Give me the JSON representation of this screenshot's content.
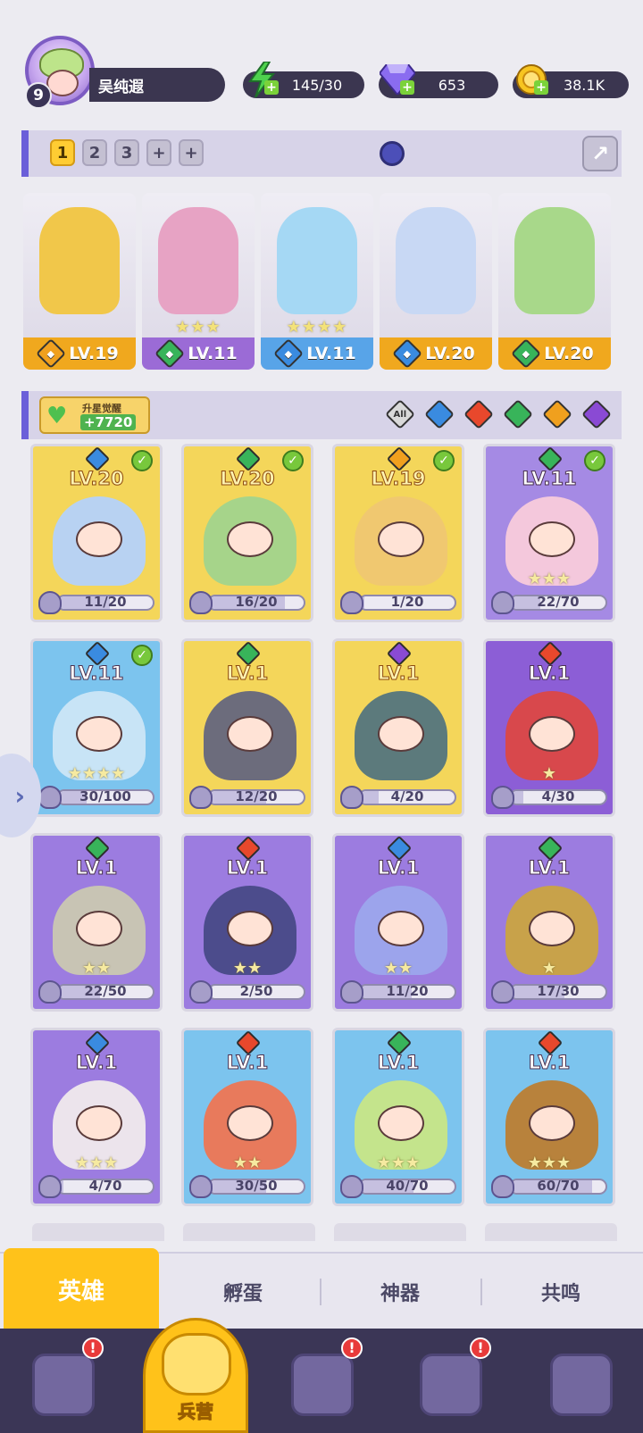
{
  "player": {
    "level": "9",
    "name": "吴纯遐"
  },
  "resources": {
    "energy": "145/30",
    "gems": "653",
    "gold": "38.1K"
  },
  "team_tabs": [
    "1",
    "2",
    "3",
    "+",
    "+"
  ],
  "team": [
    {
      "level": "LV.19",
      "element": "light",
      "stars": "",
      "strip_color": "#f0a81e",
      "art_color": "#f1c74a"
    },
    {
      "level": "LV.11",
      "element": "nature",
      "stars": "★★★",
      "strip_color": "#9b6bd6",
      "art_color": "#e7a3c4"
    },
    {
      "level": "LV.11",
      "element": "water",
      "stars": "★★★★",
      "strip_color": "#58a4e8",
      "art_color": "#a5d8f4"
    },
    {
      "level": "LV.20",
      "element": "water",
      "stars": "",
      "strip_color": "#f0a81e",
      "art_color": "#c8d8f4"
    },
    {
      "level": "LV.20",
      "element": "nature",
      "stars": "",
      "strip_color": "#f0a81e",
      "art_color": "#a8d88a"
    }
  ],
  "awaken": {
    "label": "升星觉醒",
    "value": "+7720"
  },
  "filters": [
    "All",
    "water",
    "fire",
    "nature",
    "light",
    "dark"
  ],
  "heroes": [
    {
      "level": "LV.20",
      "element": "water",
      "checked": true,
      "stars": "",
      "progress": "11/20",
      "fill": 0.55,
      "bg": "#f4d65a",
      "art": "#b8d2f2"
    },
    {
      "level": "LV.20",
      "element": "nature",
      "checked": true,
      "stars": "",
      "progress": "16/20",
      "fill": 0.8,
      "bg": "#f4d65a",
      "art": "#a6d48a"
    },
    {
      "level": "LV.19",
      "element": "light",
      "checked": true,
      "stars": "",
      "progress": "1/20",
      "fill": 0.05,
      "bg": "#f4d65a",
      "art": "#f0c870"
    },
    {
      "level": "LV.11",
      "element": "nature",
      "checked": true,
      "stars": "★★★",
      "progress": "22/70",
      "fill": 0.31,
      "bg": "#a58ae4",
      "art": "#f4c8dc"
    },
    {
      "level": "LV.11",
      "element": "water",
      "checked": true,
      "stars": "★★★★",
      "progress": "30/100",
      "fill": 0.3,
      "bg": "#7cc4ee",
      "art": "#c8e4f6"
    },
    {
      "level": "LV.1",
      "element": "nature",
      "checked": false,
      "stars": "",
      "progress": "12/20",
      "fill": 0.6,
      "bg": "#f4d65a",
      "art": "#6c6c7c"
    },
    {
      "level": "LV.1",
      "element": "dark",
      "checked": false,
      "stars": "",
      "progress": "4/20",
      "fill": 0.2,
      "bg": "#f4d65a",
      "art": "#5c7a7c"
    },
    {
      "level": "LV.1",
      "element": "fire",
      "checked": false,
      "stars": "★",
      "progress": "4/30",
      "fill": 0.13,
      "bg": "#8c5ed6",
      "art": "#d8484c"
    },
    {
      "level": "LV.1",
      "element": "nature",
      "checked": false,
      "stars": "★★",
      "progress": "22/50",
      "fill": 0.44,
      "bg": "#9c7ce0",
      "art": "#c8c4b4"
    },
    {
      "level": "LV.1",
      "element": "fire",
      "checked": false,
      "stars": "★★",
      "progress": "2/50",
      "fill": 0.04,
      "bg": "#9c7ce0",
      "art": "#4c4c8c"
    },
    {
      "level": "LV.1",
      "element": "water",
      "checked": false,
      "stars": "★★",
      "progress": "11/20",
      "fill": 0.55,
      "bg": "#9c7ce0",
      "art": "#9ca4ec"
    },
    {
      "level": "LV.1",
      "element": "nature",
      "checked": false,
      "stars": "★",
      "progress": "17/30",
      "fill": 0.57,
      "bg": "#9c7ce0",
      "art": "#c8a24a"
    },
    {
      "level": "LV.1",
      "element": "water",
      "checked": false,
      "stars": "★★★",
      "progress": "4/70",
      "fill": 0.06,
      "bg": "#9c7ce0",
      "art": "#ece4ec"
    },
    {
      "level": "LV.1",
      "element": "fire",
      "checked": false,
      "stars": "★★",
      "progress": "30/50",
      "fill": 0.6,
      "bg": "#7cc4ee",
      "art": "#e87a5c"
    },
    {
      "level": "LV.1",
      "element": "nature",
      "checked": false,
      "stars": "★★★",
      "progress": "40/70",
      "fill": 0.57,
      "bg": "#7cc4ee",
      "art": "#c4e48c"
    },
    {
      "level": "LV.1",
      "element": "fire",
      "checked": false,
      "stars": "★★★",
      "progress": "60/70",
      "fill": 0.86,
      "bg": "#7cc4ee",
      "art": "#b8823c"
    }
  ],
  "tabs": [
    "英雄",
    "孵蛋",
    "神器",
    "共鸣"
  ],
  "nav": {
    "active_label": "兵营",
    "alerts": [
      "!",
      "!",
      "!"
    ]
  },
  "element_colors": {
    "water": "#3a8be0",
    "fire": "#e8482c",
    "nature": "#38b45a",
    "light": "#f0a01e",
    "dark": "#8a4ad4"
  }
}
